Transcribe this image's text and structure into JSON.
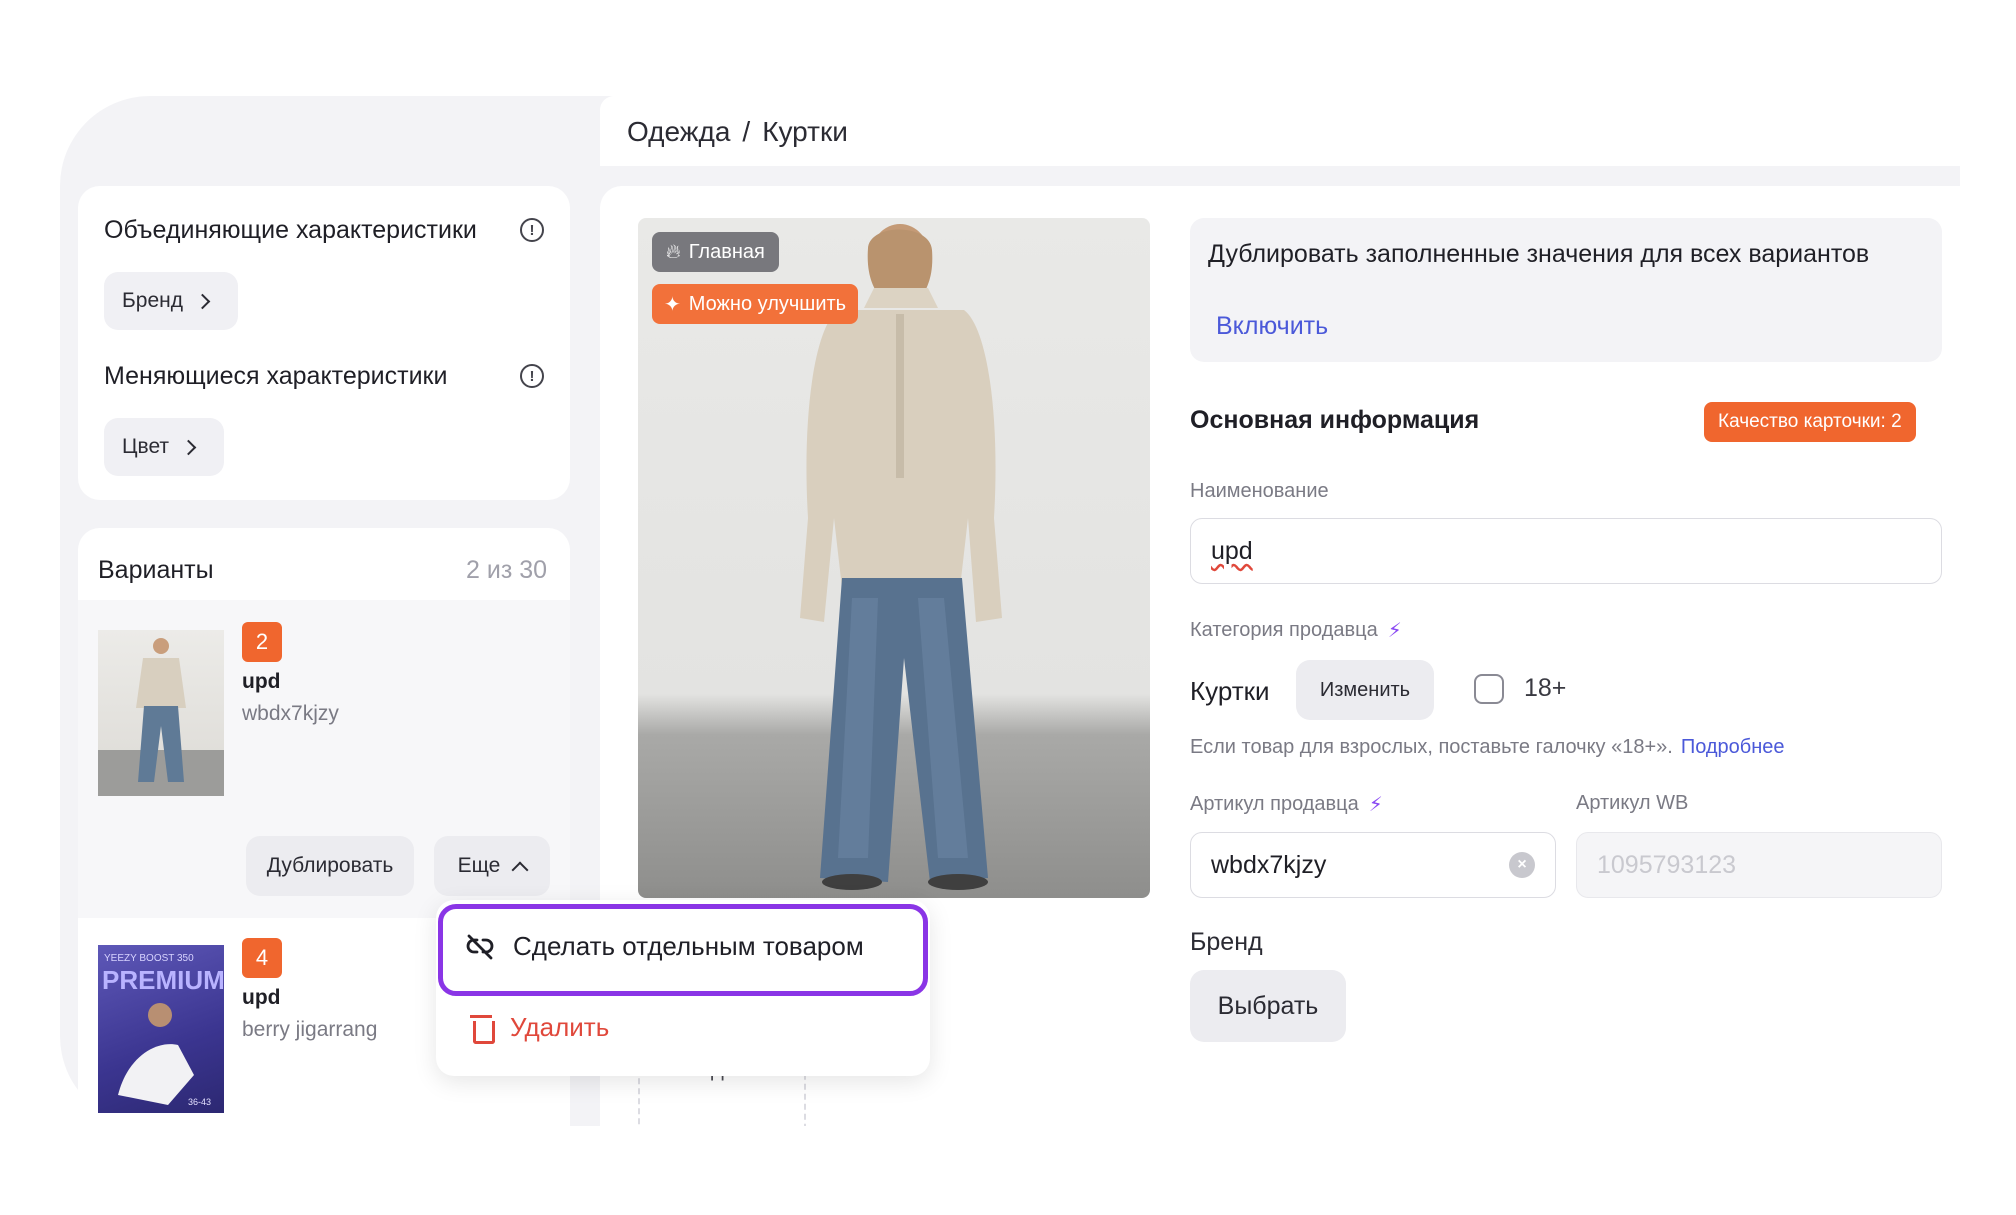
{
  "breadcrumb": {
    "part1": "Одежда",
    "separator": "/",
    "part2": "Куртки"
  },
  "characteristics": {
    "unifying_title": "Объединяющие характеристики",
    "unifying_chip": "Бренд",
    "changing_title": "Меняющиеся характеристики",
    "changing_chip": "Цвет"
  },
  "variants": {
    "title": "Варианты",
    "count": "2 из 30",
    "items": [
      {
        "badge": "2",
        "name": "upd",
        "sku": "wbdx7kjzy"
      },
      {
        "badge": "4",
        "name": "upd",
        "sku": "berry jigarrang"
      }
    ],
    "duplicate_label": "Дублировать",
    "more_label": "Еще"
  },
  "dropdown": {
    "separate_label": "Сделать отдельным товаром",
    "delete_label": "Удалить"
  },
  "photo": {
    "main_badge": "Главная",
    "improve_badge": "Можно улучшить",
    "video_label": "Видео"
  },
  "duplicate_values": {
    "text": "Дублировать заполненные значения для всех вариантов",
    "enable_label": "Включить"
  },
  "main_info": {
    "title": "Основная информация",
    "quality_badge": "Качество карточки: 2",
    "name_label": "Наименование",
    "name_value": "upd",
    "seller_category_label": "Категория продавца",
    "category_value": "Куртки",
    "change_label": "Изменить",
    "adult_label": "18+",
    "adult_hint": "Если товар для взрослых, поставьте галочку «18+».",
    "more_link": "Подробнее",
    "seller_sku_label": "Артикул продавца",
    "seller_sku_value": "wbdx7kjzy",
    "wb_sku_label": "Артикул WB",
    "wb_sku_value": "1095793123",
    "brand_label": "Бренд",
    "brand_button": "Выбрать"
  },
  "colors": {
    "accent_orange": "#f0662e",
    "link_blue": "#4b59d9",
    "menu_highlight": "#8a35e6",
    "delete_red": "#e0483b",
    "bolt_purple": "#8a4af3"
  }
}
